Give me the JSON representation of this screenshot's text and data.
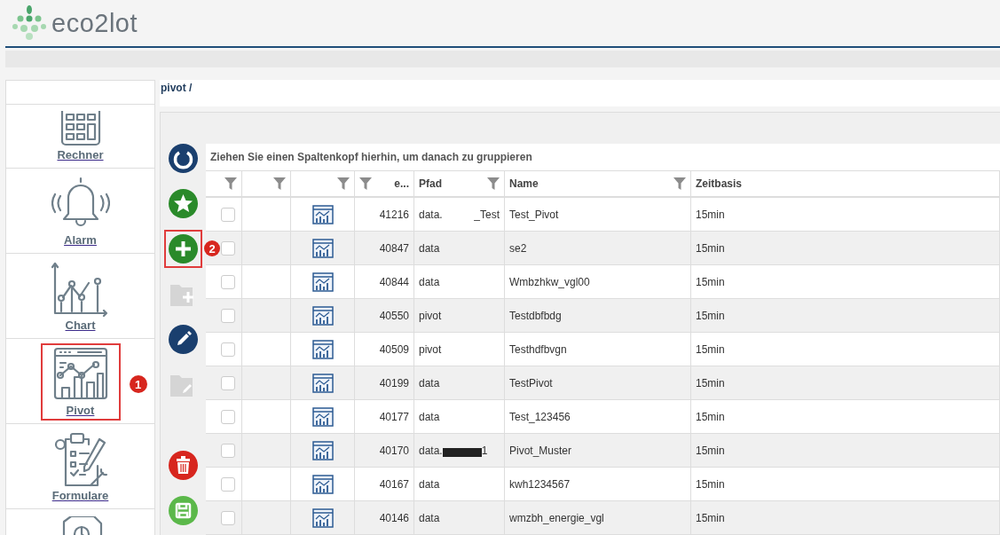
{
  "header": {
    "logo_text": "eco2lot"
  },
  "breadcrumb": "pivot /",
  "sidebar": {
    "items": [
      {
        "kind": "calculator",
        "label": "Rechner",
        "highlighted": false
      },
      {
        "kind": "bell",
        "label": "Alarm",
        "highlighted": false
      },
      {
        "kind": "chart",
        "label": "Chart",
        "highlighted": false
      },
      {
        "kind": "pivot",
        "label": "Pivot",
        "highlighted": true,
        "badge": "1"
      },
      {
        "kind": "forms",
        "label": "Formulare",
        "highlighted": false
      },
      {
        "kind": "report"
      }
    ]
  },
  "toolbar": {
    "groups": [
      [
        {
          "kind": "refresh",
          "disabled": false,
          "highlighted": false
        },
        {
          "kind": "favorite",
          "disabled": false,
          "highlighted": false
        },
        {
          "kind": "add",
          "disabled": false,
          "highlighted": true,
          "badge": "2"
        },
        {
          "kind": "add-folder",
          "disabled": true,
          "highlighted": false
        },
        {
          "kind": "edit",
          "disabled": false,
          "highlighted": false
        },
        {
          "kind": "edit-folder",
          "disabled": true,
          "highlighted": false
        }
      ],
      [
        {
          "kind": "delete",
          "disabled": false,
          "highlighted": false
        },
        {
          "kind": "save",
          "disabled": false,
          "highlighted": false
        }
      ]
    ]
  },
  "grid": {
    "group_panel": "Ziehen Sie einen Spaltenkopf hierhin, um danach zu gruppieren",
    "columns": [
      {
        "kind": "check",
        "filter": true
      },
      {
        "kind": "blank",
        "filter": true
      },
      {
        "kind": "icon",
        "filter": true
      },
      {
        "kind": "id",
        "label": "e...",
        "filter": true
      },
      {
        "kind": "path",
        "label": "Pfad",
        "filter": true
      },
      {
        "kind": "name",
        "label": "Name",
        "filter": true
      },
      {
        "kind": "timebase",
        "label": "Zeitbasis",
        "filter": false
      }
    ],
    "rows": [
      {
        "checked": false,
        "id": "41216",
        "path": "data.",
        "path_end": "_Test",
        "name": "Test_Pivot",
        "timebase": "15min"
      },
      {
        "checked": false,
        "id": "40847",
        "path": "data",
        "name": "se2",
        "timebase": "15min"
      },
      {
        "checked": false,
        "id": "40844",
        "path": "data",
        "name": "Wmbzhkw_vgl00",
        "timebase": "15min"
      },
      {
        "checked": false,
        "id": "40550",
        "path": "pivot",
        "name": "Testdbfbdg",
        "timebase": "15min"
      },
      {
        "checked": false,
        "id": "40509",
        "path": "pivot",
        "name": "Testhdfbvgn",
        "timebase": "15min"
      },
      {
        "checked": false,
        "id": "40199",
        "path": "data",
        "name": "TestPivot",
        "timebase": "15min"
      },
      {
        "checked": false,
        "id": "40177",
        "path": "data",
        "name": "Test_123456",
        "timebase": "15min"
      },
      {
        "checked": false,
        "id": "40170",
        "path": "data.",
        "path_end": "1",
        "redacted": true,
        "name": "Pivot_Muster",
        "timebase": "15min"
      },
      {
        "checked": false,
        "id": "40167",
        "path": "data",
        "name": "kwh1234567",
        "timebase": "15min"
      },
      {
        "checked": false,
        "id": "40146",
        "path": "data",
        "name": "wmzbh_energie_vgl",
        "timebase": "15min"
      }
    ]
  }
}
